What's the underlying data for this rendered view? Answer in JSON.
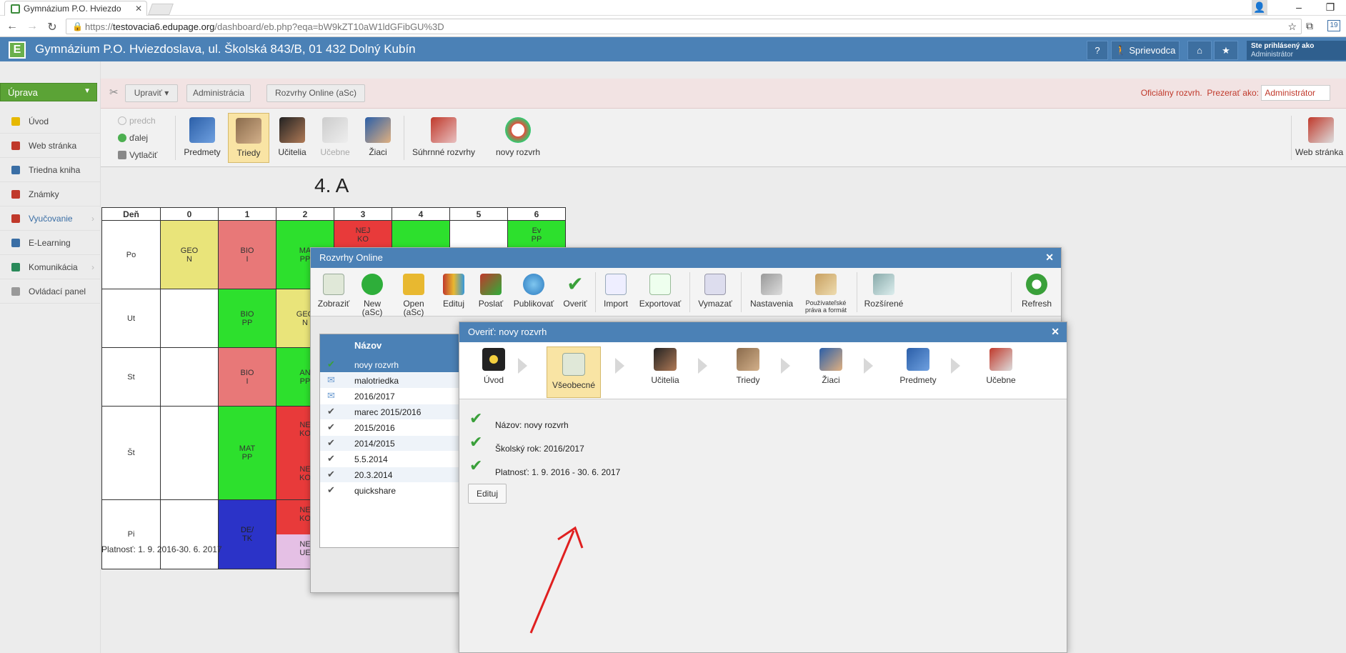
{
  "browser": {
    "tab_title": "Gymnázium P.O. Hviezdo",
    "url_scheme": "https://",
    "url_host": "testovacia6.edupage.org",
    "url_path": "/dashboard/eb.php?eqa=bW9kZT10aW1ldGFibGU%3D",
    "badge": "19"
  },
  "header": {
    "school": "Gymnázium P.O. Hviezdoslava, ul. Školská 843/B, 01 432 Dolný Kubín",
    "help": "?",
    "guide": "Sprievodca",
    "user_line1": "Ste prihlásený ako",
    "user_line2": "Administrátor"
  },
  "sidebar": {
    "menu_button": "Úprava",
    "items": [
      {
        "label": "Úvod",
        "color": "#e6b800"
      },
      {
        "label": "Web stránka",
        "color": "#c0392b"
      },
      {
        "label": "Triedna kniha",
        "color": "#3a6ea5"
      },
      {
        "label": "Známky",
        "color": "#c0392b"
      },
      {
        "label": "Vyučovanie",
        "color": "#c0392b"
      },
      {
        "label": "E-Learning",
        "color": "#3a6ea5"
      },
      {
        "label": "Komunikácia",
        "color": "#2a8a5a"
      },
      {
        "label": "Ovládací panel",
        "color": "#999999"
      }
    ]
  },
  "topbar": {
    "edit": "Upraviť ▾",
    "admin": "Administrácia",
    "online": "Rozvrhy Online (aSc)",
    "official": "Oficiálny rozvrh.",
    "view_as": "Prezerať ako:",
    "view_as_value": "Administrátor"
  },
  "toolbar": {
    "prev": "predch",
    "next": "ďalej",
    "print": "Vytlačiť",
    "subjects": "Predmety",
    "classes": "Triedy",
    "teachers": "Učitelia",
    "rooms": "Učebne",
    "students": "Žiaci",
    "summary": "Súhrnné rozvrhy",
    "new_tt": "novy rozvrh",
    "web": "Web stránka"
  },
  "timetable": {
    "title": "4. A",
    "header": [
      "Deň",
      "0",
      "1",
      "2",
      "3",
      "4",
      "5",
      "6"
    ],
    "days": [
      "Po",
      "Ut",
      "St",
      "Št",
      "Pi"
    ],
    "cells": {
      "po0": "GEO\nN",
      "po1": "BIO\nI",
      "po2": "MA\nPP",
      "po3": "NEJ\nKO",
      "po6": "Ev\nPP",
      "ut1": "BIO\nPP",
      "ut2": "GEO\nN",
      "st1": "BIO\nI",
      "st2": "AN\nPP",
      "st_1": "MAT\nPP",
      "st_2a": "NE\nKO",
      "st_2b": "NE\nKO",
      "pi1": "DE/\nTK",
      "pi2a": "NE\nKO",
      "pi2b": "NE\nUE"
    },
    "validity": "Platnosť: 1. 9. 2016-30. 6. 2017"
  },
  "dialog1": {
    "title": "Rozvrhy Online",
    "buttons": [
      "Zobraziť",
      "New\n(aSc)",
      "Open\n(aSc)",
      "Edituj",
      "Poslať",
      "Publikovať",
      "Overiť",
      "Import",
      "Exportovať",
      "Vymazať",
      "Nastavenia",
      "Používateľské\npráva a formát",
      "Rozšírené",
      "Refresh"
    ],
    "list_header": "Názov",
    "list": [
      "novy rozvrh",
      "malotriedka",
      "2016/2017",
      "marec 2015/2016",
      "2015/2016",
      "2014/2015",
      "5.5.2014",
      "20.3.2014",
      "quickshare"
    ]
  },
  "dialog2": {
    "title": "Overiť: novy rozvrh",
    "steps": [
      "Úvod",
      "Všeobecné",
      "Učitelia",
      "Triedy",
      "Žiaci",
      "Predmety",
      "Učebne"
    ],
    "checks": [
      "Názov: novy rozvrh",
      "Školský rok: 2016/2017",
      "Platnosť: 1. 9. 2016 - 30. 6. 2017"
    ],
    "edit": "Edituj"
  }
}
